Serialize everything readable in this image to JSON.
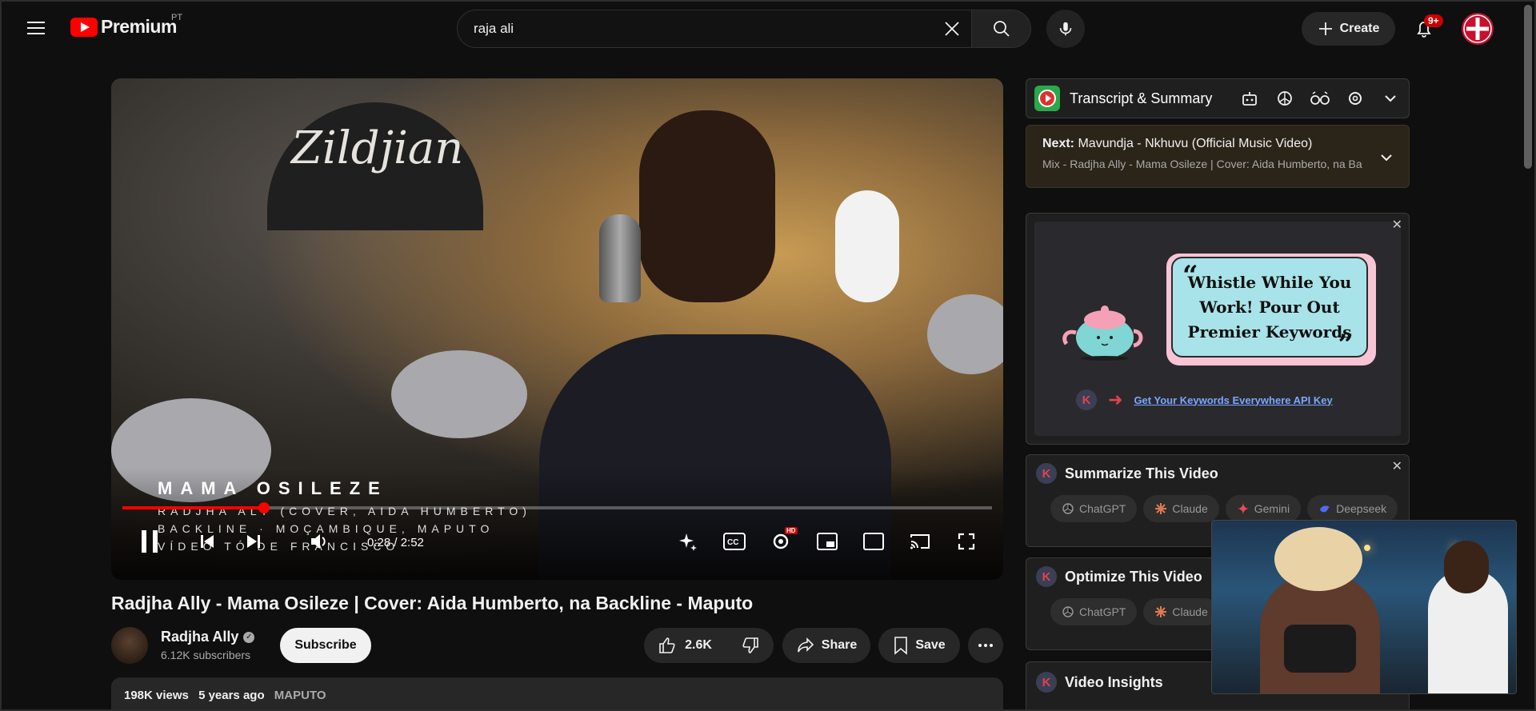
{
  "header": {
    "logo_text": "Premium",
    "logo_country": "PT",
    "search_value": "raja ali",
    "create_label": "Create",
    "notifications_badge": "9+"
  },
  "player": {
    "overlay_title": "MAMA OSILEZE",
    "overlay_line1": "RADJHA ALY (COVER, AIDA HUMBERTO)",
    "overlay_line2": "BACKLINE · MOÇAMBIQUE, MAPUTO",
    "overlay_line3": "VÍDEO TÓ DE FRANCISCO",
    "brand_text": "Zildjian",
    "time_display": "0:28 / 2:52",
    "progress_fraction": 0.163,
    "hd_badge": "HD"
  },
  "video": {
    "title": "Radjha Ally - Mama Osileze | Cover: Aida Humberto, na Backline - Maputo",
    "channel_name": "Radjha Ally",
    "subscribers": "6.12K subscribers",
    "subscribe_label": "Subscribe",
    "likes": "2.6K",
    "share_label": "Share",
    "save_label": "Save",
    "views": "198K views",
    "age": "5 years ago",
    "tag": "MAPUTO"
  },
  "sidebar": {
    "transcript_title": "Transcript & Summary",
    "next_label": "Next:",
    "next_video": "Mavundja - Nkhuvu (Official Music Video)",
    "next_mix": "Mix - Radjha Ally - Mama Osileze | Cover: Aida Humberto, na Backline - Maputo",
    "ad_text": "Whistle While You Work! Pour Out Premier Keywords",
    "ad_k": "K",
    "ad_link": "Get Your Keywords Everywhere API Key",
    "summarize_title": "Summarize This Video",
    "optimize_title": "Optimize This Video",
    "insights_title": "Video Insights",
    "chip_chatgpt": "ChatGPT",
    "chip_claude": "Claude",
    "chip_gemini": "Gemini",
    "chip_deepseek": "Deepseek"
  },
  "colors": {
    "accent_red": "#ff0000",
    "panel_bg": "#1f1f1f",
    "link_blue": "#7aa7ff"
  }
}
